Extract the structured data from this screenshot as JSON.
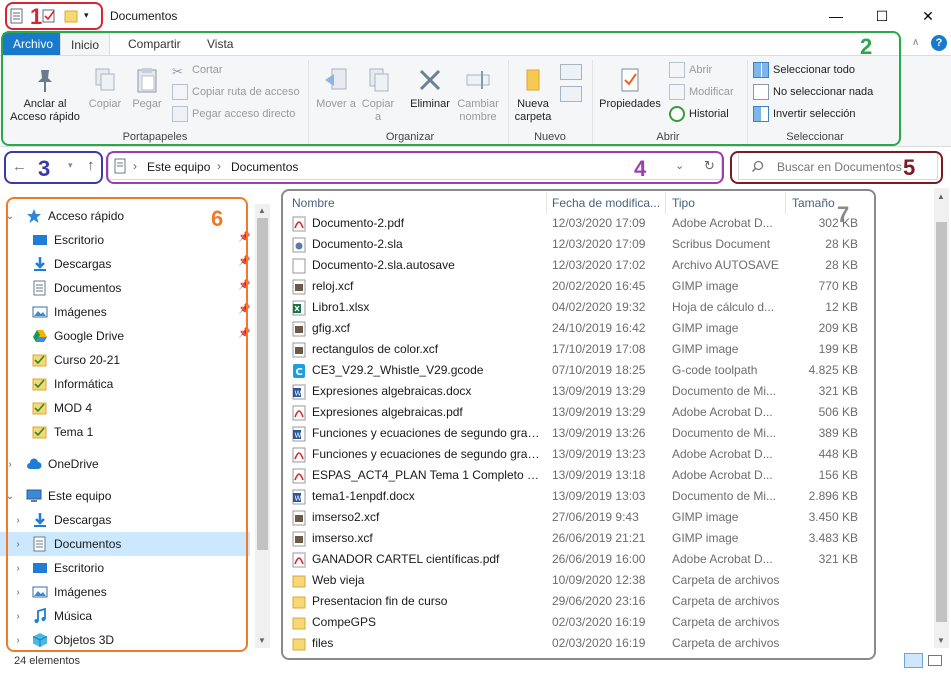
{
  "window": {
    "title": "Documentos",
    "min_glyph": "—",
    "max_glyph": "☐",
    "close_glyph": "✕"
  },
  "ribbon": {
    "tabs": [
      "Archivo",
      "Inicio",
      "Compartir",
      "Vista"
    ],
    "help_glyph": "?",
    "portapapeles": {
      "label": "Portapapeles",
      "anclar": "Anclar al Acceso rápido",
      "copiar": "Copiar",
      "pegar": "Pegar",
      "cortar": "Cortar",
      "copiar_ruta": "Copiar ruta de acceso",
      "pegar_acceso": "Pegar acceso directo"
    },
    "organizar": {
      "label": "Organizar",
      "mover": "Mover a",
      "copiar": "Copiar a",
      "eliminar": "Eliminar",
      "cambiar": "Cambiar nombre"
    },
    "nuevo": {
      "label": "Nuevo",
      "nueva_carpeta": "Nueva carpeta"
    },
    "abrir": {
      "label": "Abrir",
      "propiedades": "Propiedades",
      "abrir": "Abrir",
      "modificar": "Modificar",
      "historial": "Historial"
    },
    "seleccionar": {
      "label": "Seleccionar",
      "todo": "Seleccionar todo",
      "nada": "No seleccionar nada",
      "invertir": "Invertir selección"
    }
  },
  "address": {
    "crumbs": [
      "Este equipo",
      "Documentos"
    ],
    "search_placeholder": "Buscar en Documentos"
  },
  "annotations": [
    "1",
    "2",
    "3",
    "4",
    "5",
    "6",
    "7"
  ],
  "nav_pane": [
    {
      "label": "Acceso rápido",
      "icon": "star-icon",
      "level": 0,
      "expanded": true
    },
    {
      "label": "Escritorio",
      "icon": "desktop-icon",
      "level": 1,
      "pinned": true
    },
    {
      "label": "Descargas",
      "icon": "download-icon",
      "level": 1,
      "pinned": true
    },
    {
      "label": "Documentos",
      "icon": "document-icon",
      "level": 1,
      "pinned": true
    },
    {
      "label": "Imágenes",
      "icon": "image-icon",
      "level": 1,
      "pinned": true
    },
    {
      "label": "Google Drive",
      "icon": "google-drive-icon",
      "level": 1,
      "pinned": true
    },
    {
      "label": "Curso 20-21",
      "icon": "folder-check-icon",
      "level": 1
    },
    {
      "label": "Informática",
      "icon": "folder-check-icon",
      "level": 1
    },
    {
      "label": "MOD 4",
      "icon": "folder-check-icon",
      "level": 1
    },
    {
      "label": "Tema 1",
      "icon": "folder-check-icon",
      "level": 1
    },
    {
      "label": "OneDrive",
      "icon": "cloud-icon",
      "level": 0,
      "gap": true
    },
    {
      "label": "Este equipo",
      "icon": "computer-icon",
      "level": 0,
      "expanded": true,
      "gap": true
    },
    {
      "label": "Descargas",
      "icon": "download-icon",
      "level": 1
    },
    {
      "label": "Documentos",
      "icon": "document-icon",
      "level": 1,
      "selected": true
    },
    {
      "label": "Escritorio",
      "icon": "desktop-icon",
      "level": 1
    },
    {
      "label": "Imágenes",
      "icon": "image-icon",
      "level": 1
    },
    {
      "label": "Música",
      "icon": "music-icon",
      "level": 1
    },
    {
      "label": "Objetos 3D",
      "icon": "cube-icon",
      "level": 1
    }
  ],
  "columns": [
    "Nombre",
    "Fecha de modifica...",
    "Tipo",
    "Tamaño"
  ],
  "files": [
    {
      "name": "Documento-2.pdf",
      "date": "12/03/2020 17:09",
      "type": "Adobe Acrobat D...",
      "size": "302 KB",
      "icon": "pdf"
    },
    {
      "name": "Documento-2.sla",
      "date": "12/03/2020 17:09",
      "type": "Scribus Document",
      "size": "28 KB",
      "icon": "sla"
    },
    {
      "name": "Documento-2.sla.autosave",
      "date": "12/03/2020 17:02",
      "type": "Archivo AUTOSAVE",
      "size": "28 KB",
      "icon": "blank"
    },
    {
      "name": "reloj.xcf",
      "date": "20/02/2020 16:45",
      "type": "GIMP image",
      "size": "770 KB",
      "icon": "gimp"
    },
    {
      "name": "Libro1.xlsx",
      "date": "04/02/2020 19:32",
      "type": "Hoja de cálculo d...",
      "size": "12 KB",
      "icon": "xlsx"
    },
    {
      "name": "gfig.xcf",
      "date": "24/10/2019 16:42",
      "type": "GIMP image",
      "size": "209 KB",
      "icon": "gimp"
    },
    {
      "name": "rectangulos de color.xcf",
      "date": "17/10/2019 17:08",
      "type": "GIMP image",
      "size": "199 KB",
      "icon": "gimp"
    },
    {
      "name": "CE3_V29.2_Whistle_V29.gcode",
      "date": "07/10/2019 18:25",
      "type": "G-code toolpath",
      "size": "4.825 KB",
      "icon": "gcode"
    },
    {
      "name": "Expresiones algebraicas.docx",
      "date": "13/09/2019 13:29",
      "type": "Documento de Mi...",
      "size": "321 KB",
      "icon": "docx"
    },
    {
      "name": "Expresiones algebraicas.pdf",
      "date": "13/09/2019 13:29",
      "type": "Adobe Acrobat D...",
      "size": "506 KB",
      "icon": "pdf"
    },
    {
      "name": "Funciones y ecuaciones de segundo grad...",
      "date": "13/09/2019 13:26",
      "type": "Documento de Mi...",
      "size": "389 KB",
      "icon": "docx"
    },
    {
      "name": "Funciones y ecuaciones de segundo grad...",
      "date": "13/09/2019 13:23",
      "type": "Adobe Acrobat D...",
      "size": "448 KB",
      "icon": "pdf"
    },
    {
      "name": "ESPAS_ACT4_PLAN Tema 1 Completo Fu...",
      "date": "13/09/2019 13:18",
      "type": "Adobe Acrobat D...",
      "size": "156 KB",
      "icon": "pdf"
    },
    {
      "name": "tema1-1enpdf.docx",
      "date": "13/09/2019 13:03",
      "type": "Documento de Mi...",
      "size": "2.896 KB",
      "icon": "docx"
    },
    {
      "name": "imserso2.xcf",
      "date": "27/06/2019 9:43",
      "type": "GIMP image",
      "size": "3.450 KB",
      "icon": "gimp"
    },
    {
      "name": "imserso.xcf",
      "date": "26/06/2019 21:21",
      "type": "GIMP image",
      "size": "3.483 KB",
      "icon": "gimp"
    },
    {
      "name": "GANADOR CARTEL científicas.pdf",
      "date": "26/06/2019 16:00",
      "type": "Adobe Acrobat D...",
      "size": "321 KB",
      "icon": "pdf"
    },
    {
      "name": "Web vieja",
      "date": "10/09/2020 12:38",
      "type": "Carpeta de archivos",
      "size": "",
      "icon": "folder"
    },
    {
      "name": "Presentacion fin de curso",
      "date": "29/06/2020 23:16",
      "type": "Carpeta de archivos",
      "size": "",
      "icon": "folder"
    },
    {
      "name": "CompeGPS",
      "date": "02/03/2020 16:19",
      "type": "Carpeta de archivos",
      "size": "",
      "icon": "folder"
    },
    {
      "name": "files",
      "date": "02/03/2020 16:19",
      "type": "Carpeta de archivos",
      "size": "",
      "icon": "folder"
    }
  ],
  "status": {
    "count": "24 elementos"
  },
  "colors": {
    "file_tab": "#1979ca",
    "selection": "#cce8ff",
    "ann1": "#d7262e",
    "ann2": "#2aa84a",
    "ann3": "#3a3aa8",
    "ann4": "#9b3fb0",
    "ann5": "#7a1a25",
    "ann6": "#ef7b2a",
    "ann7": "#8a8a8a"
  }
}
